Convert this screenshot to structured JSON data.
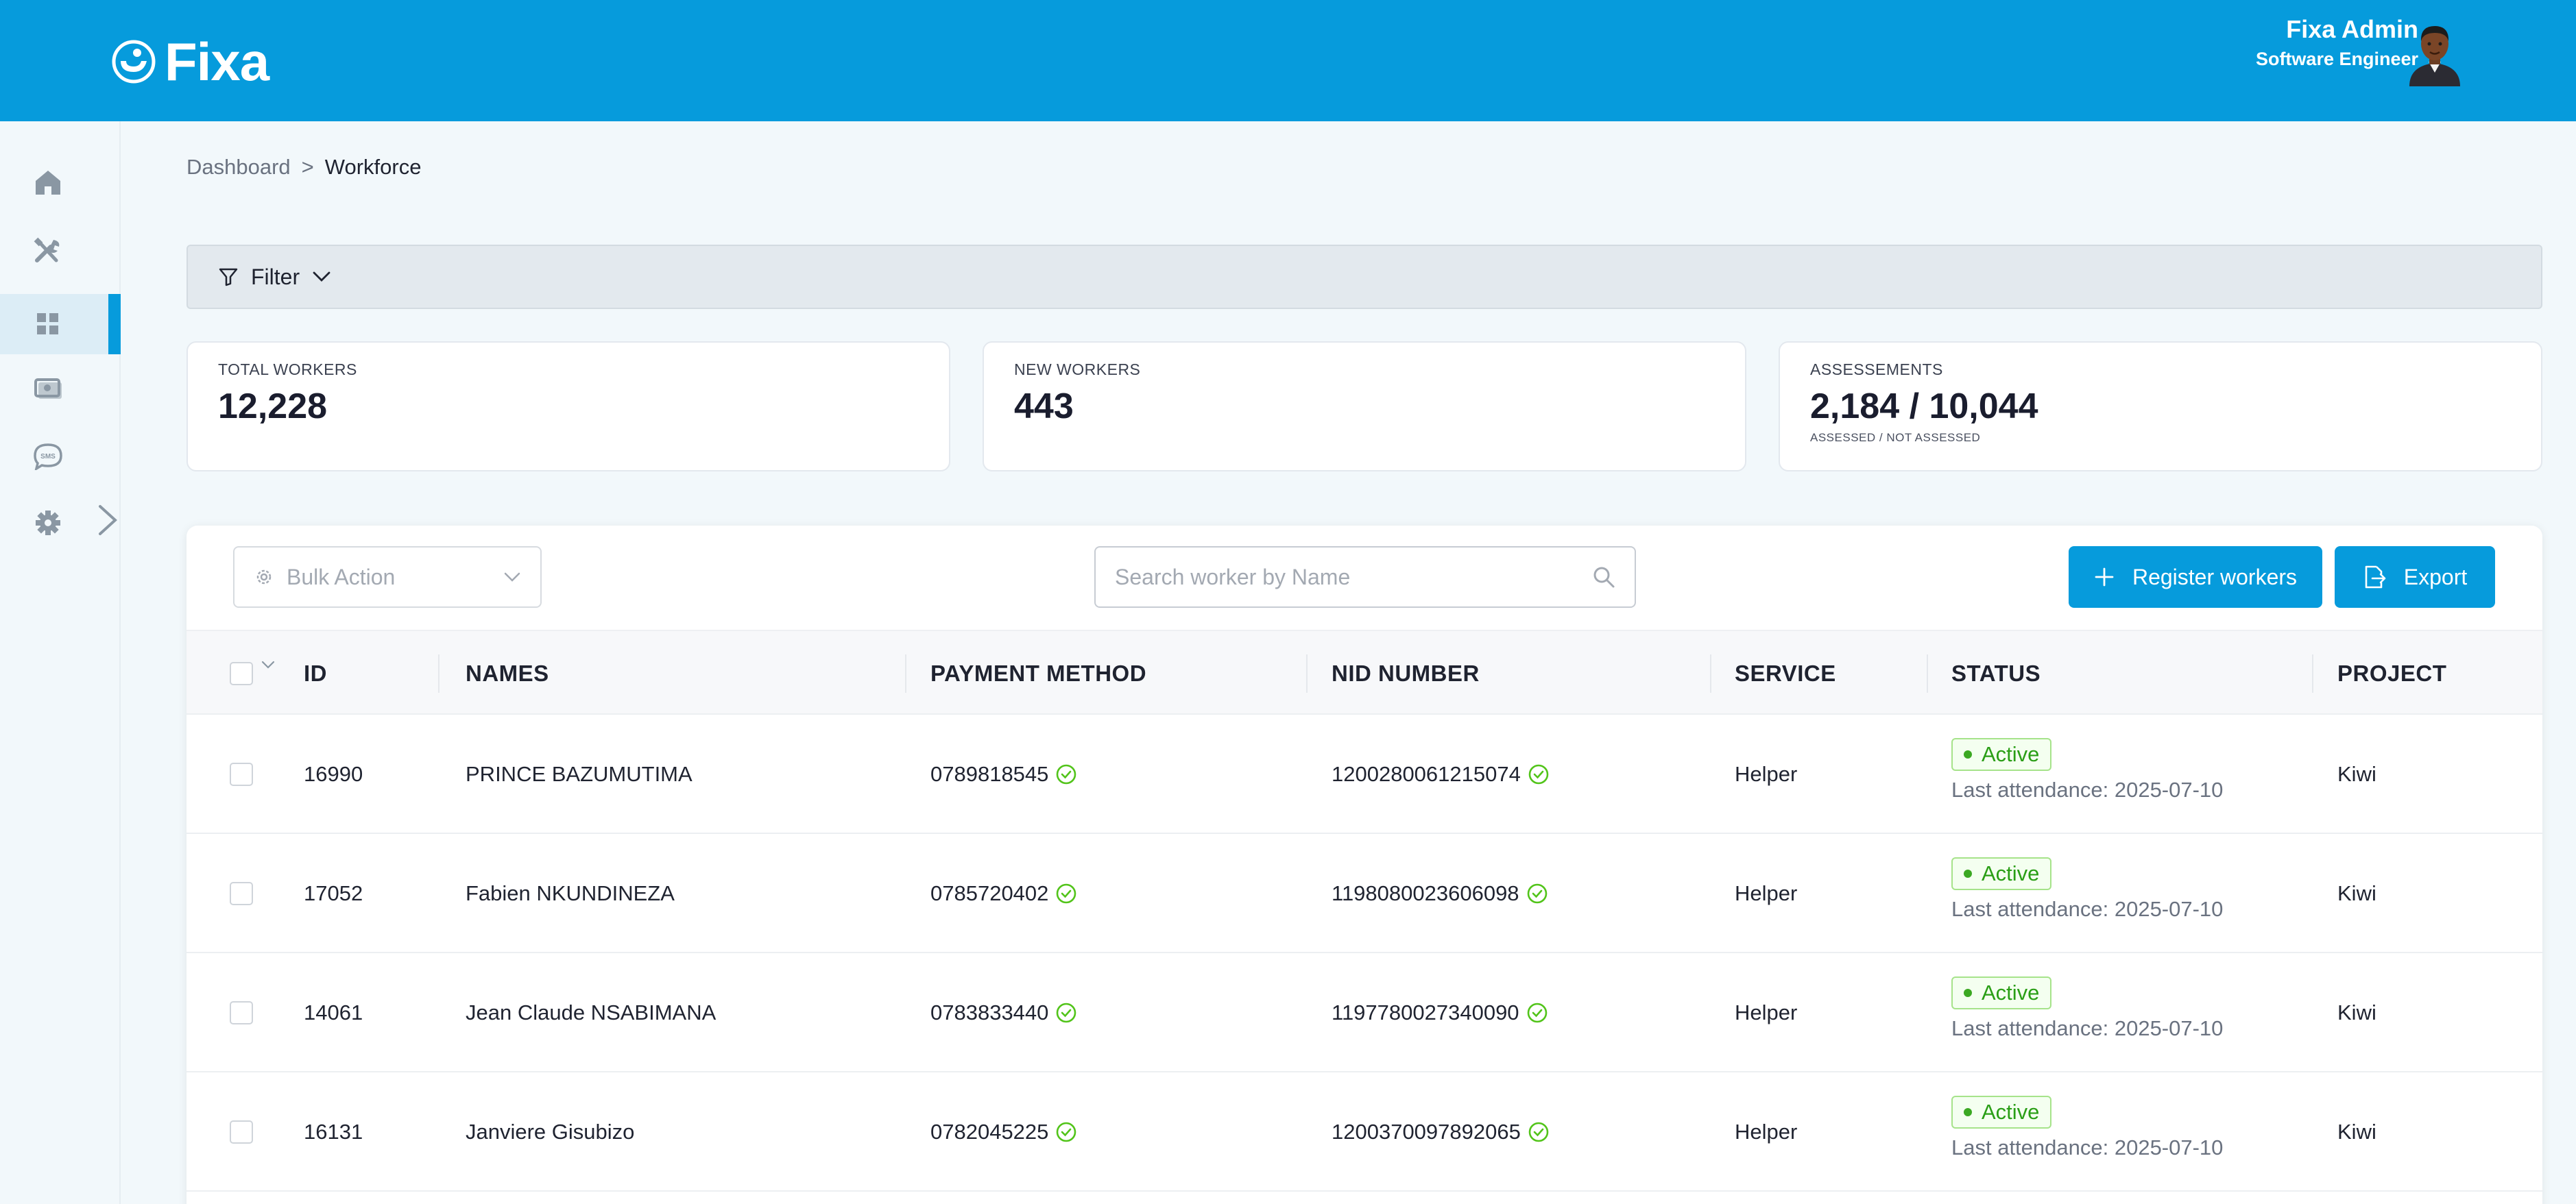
{
  "header": {
    "logo_text": "Fixa",
    "user_name": "Fixa Admin",
    "user_role": "Software Engineer"
  },
  "sidebar": {
    "items": [
      {
        "icon": "home-icon",
        "active": false
      },
      {
        "icon": "tools-icon",
        "active": false
      },
      {
        "icon": "grid-icon",
        "active": true
      },
      {
        "icon": "money-icon",
        "active": false
      },
      {
        "icon": "sms-icon",
        "active": false
      },
      {
        "icon": "gear-icon",
        "active": false
      }
    ],
    "sms_glyph": "SMS"
  },
  "breadcrumb": {
    "root": "Dashboard",
    "separator": ">",
    "current": "Workforce"
  },
  "filter": {
    "label": "Filter"
  },
  "stats": {
    "total_workers": {
      "label": "TOTAL WORKERS",
      "value": "12,228"
    },
    "new_workers": {
      "label": "NEW WORKERS",
      "value": "443"
    },
    "assessments": {
      "label": "ASSESSEMENTS",
      "value": "2,184 / 10,044",
      "sub": "ASSESSED / NOT ASSESSED"
    }
  },
  "toolbar": {
    "bulk_action": "Bulk Action",
    "search_placeholder": "Search worker by Name",
    "register_label": "Register workers",
    "export_label": "Export"
  },
  "table": {
    "headers": [
      "ID",
      "NAMES",
      "PAYMENT METHOD",
      "NID NUMBER",
      "SERVICE",
      "STATUS",
      "PROJECT"
    ],
    "rows": [
      {
        "id": "16990",
        "name": "PRINCE BAZUMUTIMA",
        "payment": "0789818545",
        "nid": "1200280061215074",
        "service": "Helper",
        "status": "Active",
        "last_attendance": "Last attendance: 2025-07-10",
        "project": "Kiwi"
      },
      {
        "id": "17052",
        "name": "Fabien NKUNDINEZA",
        "payment": "0785720402",
        "nid": "1198080023606098",
        "service": "Helper",
        "status": "Active",
        "last_attendance": "Last attendance: 2025-07-10",
        "project": "Kiwi"
      },
      {
        "id": "14061",
        "name": "Jean Claude NSABIMANA",
        "payment": "0783833440",
        "nid": "1197780027340090",
        "service": "Helper",
        "status": "Active",
        "last_attendance": "Last attendance: 2025-07-10",
        "project": "Kiwi"
      },
      {
        "id": "16131",
        "name": "Janviere Gisubizo",
        "payment": "0782045225",
        "nid": "1200370097892065",
        "service": "Helper",
        "status": "Active",
        "last_attendance": "Last attendance: 2025-07-10",
        "project": "Kiwi"
      }
    ]
  },
  "colors": {
    "brand": "#069bdc",
    "active_green": "#2a9e16",
    "verified_green": "#52c41a"
  }
}
